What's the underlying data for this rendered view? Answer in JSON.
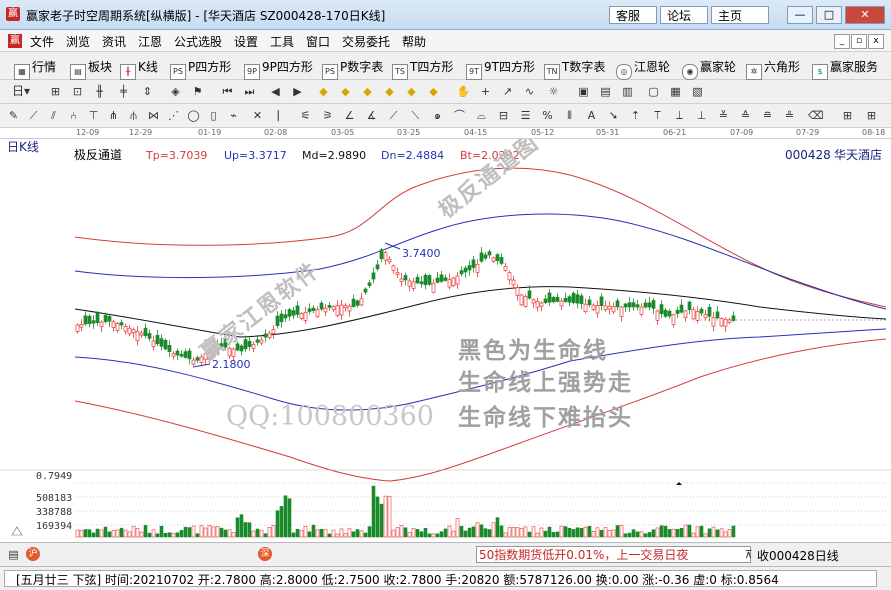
{
  "window": {
    "app_title": "赢家老子时空周期系统[纵横版] - [华天酒店  SZ000428-170日K线]",
    "buttons": [
      "客服",
      "论坛",
      "主页"
    ],
    "controls": [
      "—",
      "□",
      "✕"
    ]
  },
  "menu": [
    "文件",
    "浏览",
    "资讯",
    "江恩",
    "公式选股",
    "设置",
    "工具",
    "窗口",
    "交易委托",
    "帮助"
  ],
  "toolbar": [
    "行情",
    "板块",
    "K线",
    "P四方形",
    "9P四方形",
    "P数字表",
    "T四方形",
    "9T四方形",
    "T数字表",
    "江恩轮",
    "赢家轮",
    "六角形",
    "赢家服务"
  ],
  "toolbar_icons": [
    "PS",
    "9P",
    "PS",
    "TS",
    "9T",
    "TN"
  ],
  "toolbar2": {
    "period_label": "日"
  },
  "date_axis": [
    "12-09",
    "12-29",
    "01-19",
    "02-08",
    "03-05",
    "03-25",
    "04-15",
    "05-12",
    "05-31",
    "06-21",
    "07-09",
    "07-29",
    "08-18"
  ],
  "chart": {
    "period_label": "日K线",
    "indicator_name": "极反通道",
    "tp_label": "Tp=3.7039",
    "up_label": "Up=3.3717",
    "md_label": "Md=2.9890",
    "dn_label": "Dn=2.4884",
    "bt_label": "Bt=2.0292",
    "stock_code": "000428",
    "stock_name": "华天酒店",
    "peak_label": "3.7400",
    "trough_label": "2.1800",
    "watermark_diag1": "赢家江恩软件",
    "watermark_diag2": "极反通道图",
    "note1": "黑色为生命线",
    "note2": "生命线上强势走",
    "note3": "生命线下难抬头",
    "qq": "QQ:100800360",
    "volume_scale": [
      "0.7949",
      "508183",
      "338788",
      "169394"
    ],
    "colors": {
      "up": "#e53935",
      "down": "#1b8a2b",
      "outer": "#d33c3c",
      "inner": "#2433b3",
      "mid": "#111111"
    }
  },
  "chart_data": {
    "type": "candlestick",
    "period": "daily",
    "channel": {
      "Tp": 3.7039,
      "Up": 3.3717,
      "Md": 2.989,
      "Dn": 2.4884,
      "Bt": 2.0292
    },
    "marked_high": 3.74,
    "marked_low": 2.18,
    "volume_ticks": [
      169394,
      338788,
      508183
    ],
    "last_bar": {
      "date": "2021-07-02",
      "open": 2.78,
      "high": 2.8,
      "low": 2.75,
      "close": 2.78,
      "hand": 20820,
      "amount": 5787126.0
    }
  },
  "status1": {
    "left_icon": "沪",
    "mid_icon": "深",
    "ticker": "50指数期货低开0.01%，上一交易日夜",
    "right": "收000428日线"
  },
  "status2": {
    "text": "[五月廿三  下弦] 时间:20210702 开:2.7800 高:2.8000 低:2.7500 收:2.7800 手:20820 额:5787126.00 换:0.00 涨:-0.36 虚:0 标:0.8564"
  }
}
